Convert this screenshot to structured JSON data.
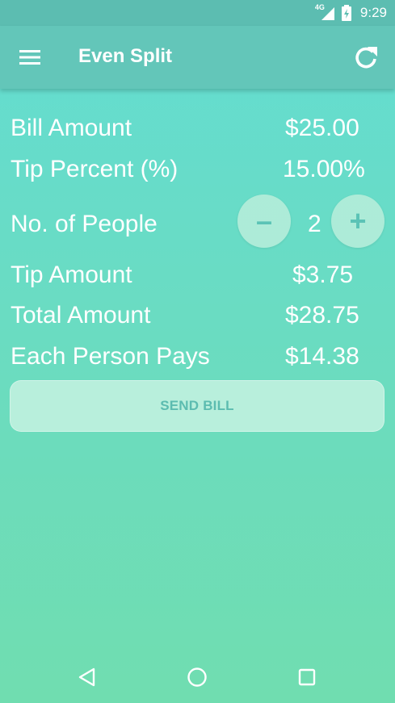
{
  "status_bar": {
    "network": "4G",
    "time": "9:29"
  },
  "toolbar": {
    "title": "Even Split",
    "menu_icon": "hamburger-menu-icon",
    "refresh_icon": "refresh-icon"
  },
  "calculator": {
    "bill_amount": {
      "label": "Bill Amount",
      "value": "$25.00"
    },
    "tip_percent": {
      "label": "Tip Percent (%)",
      "value": "15.00%"
    },
    "people": {
      "label": "No. of People",
      "value": "2",
      "decrement_label": "–",
      "increment_label": "+"
    },
    "tip_amount": {
      "label": "Tip Amount",
      "value": "$3.75"
    },
    "total_amount": {
      "label": "Total Amount",
      "value": "$28.75"
    },
    "each_person_pays": {
      "label": "Each Person Pays",
      "value": "$14.38"
    }
  },
  "actions": {
    "send_bill_label": "SEND BILL"
  },
  "colors": {
    "status_bar": "#5cbdb1",
    "toolbar": "#63c6b9",
    "background_top": "#63ddd2",
    "background_bottom": "#70ddb0",
    "button_fill": "#b8efdc",
    "button_text": "#5cbcb0"
  }
}
